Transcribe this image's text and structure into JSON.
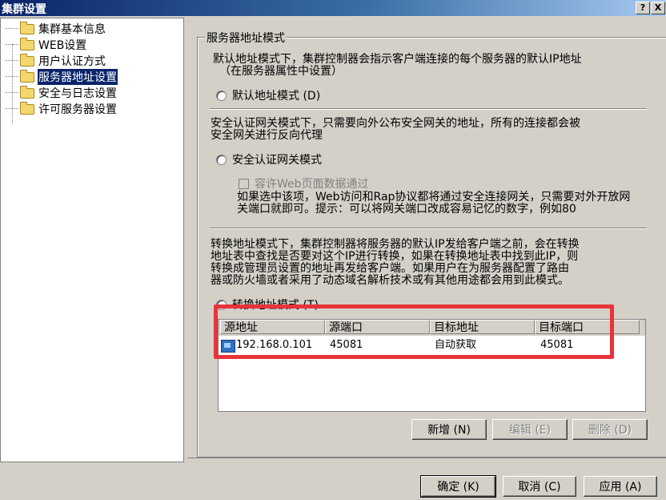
{
  "window": {
    "title": "集群设置",
    "help_label": "?",
    "close_label": "X"
  },
  "tree": {
    "items": [
      {
        "label": "集群基本信息",
        "selected": false
      },
      {
        "label": "WEB设置",
        "selected": false
      },
      {
        "label": "用户认证方式",
        "selected": false
      },
      {
        "label": "服务器地址设置",
        "selected": true
      },
      {
        "label": "安全与日志设置",
        "selected": false
      },
      {
        "label": "许可服务器设置",
        "selected": false
      }
    ]
  },
  "group": {
    "title": "服务器地址模式",
    "default_desc_1": "默认地址模式下，集群控制器会指示客户端连接的每个服务器的默认IP地址",
    "default_desc_2": "（在服务器属性中设置）",
    "default_radio": "默认地址模式 (D)",
    "gateway_desc_1": "安全认证网关模式下，只需要向外公布安全网关的地址，所有的连接都会被",
    "gateway_desc_2": "安全网关进行反向代理",
    "gateway_radio": "安全认证网关模式",
    "web_checkbox": "容许Web页面数据通过",
    "web_desc_1": "如果选中该项，Web访问和Rap协议都将通过安全连接网关，只需要对外开放网",
    "web_desc_2": "关端口就即可。提示：可以将网关端口改成容易记忆的数字，例如80",
    "translate_desc_1": "转换地址模式下，集群控制器将服务器的默认IP发给客户端之前，会在转换",
    "translate_desc_2": "地址表中查找是否要对这个IP进行转换，如果在转换地址表中找到此IP，则",
    "translate_desc_3": "转换成管理员设置的地址再发给客户端。如果用户在为服务器配置了路由",
    "translate_desc_4": "器或防火墙或者采用了动态域名解析技术或有其他用途都会用到此模式。",
    "translate_radio": "转换地址模式 (T)"
  },
  "table": {
    "columns": [
      "源地址",
      "源端口",
      "目标地址",
      "目标端口"
    ],
    "rows": [
      {
        "icon": "computer-icon",
        "src_addr": "192.168.0.101",
        "src_port": "45081",
        "dst_addr": "自动获取",
        "dst_port": "45081"
      }
    ]
  },
  "table_buttons": {
    "add": "新增 (N)",
    "edit": "编辑 (E)",
    "delete": "删除 (D)"
  },
  "dialog_buttons": {
    "ok": "确定 (K)",
    "cancel": "取消 (C)",
    "apply": "应用 (A)"
  },
  "colors": {
    "highlight_box": "#e8333a",
    "selection": "#0a246a",
    "title_bar": "#0a246a"
  }
}
